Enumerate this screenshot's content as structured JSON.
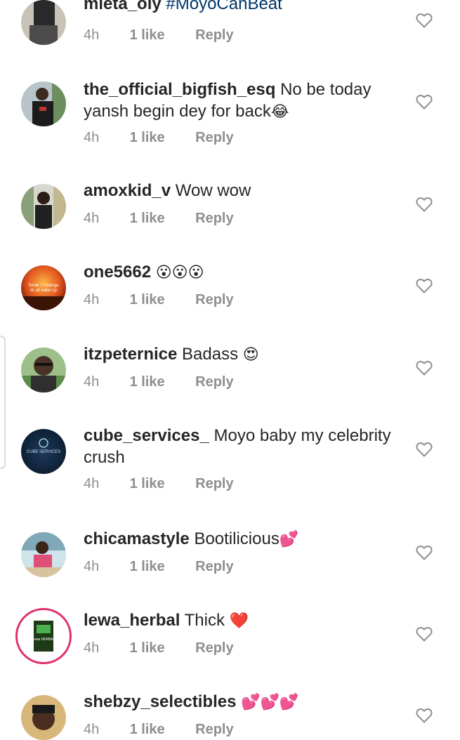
{
  "comments": [
    {
      "username": "mieta_oly",
      "text": "#MoyoCanBeat",
      "time": "4h",
      "likes": "1 like",
      "reply": "Reply"
    },
    {
      "username": "the_official_bigfish_esq",
      "text": "No be today yansh begin dey for back",
      "emoji": "😂",
      "time": "4h",
      "likes": "1 like",
      "reply": "Reply"
    },
    {
      "username": "amoxkid_v",
      "text": "Wow wow",
      "time": "4h",
      "likes": "1 like",
      "reply": "Reply"
    },
    {
      "username": "one5662",
      "text": "",
      "emoji": "😮😮😮",
      "time": "4h",
      "likes": "1 like",
      "reply": "Reply",
      "avatar_text": "Smile ! I change its all wake up"
    },
    {
      "username": "itzpeternice",
      "text": "Badass",
      "emoji": "😍",
      "time": "4h",
      "likes": "1 like",
      "reply": "Reply"
    },
    {
      "username": "cube_services_",
      "text": "Moyo baby my celebrity crush",
      "time": "4h",
      "likes": "1 like",
      "reply": "Reply",
      "avatar_text": "CUBE SERVICES"
    },
    {
      "username": "chicamastyle",
      "text": "Bootilicious",
      "emoji": "💕",
      "time": "4h",
      "likes": "1 like",
      "reply": "Reply"
    },
    {
      "username": "lewa_herbal",
      "text": "Thick",
      "emoji": "❤️",
      "time": "4h",
      "likes": "1 like",
      "reply": "Reply",
      "avatar_text": "Lewa HERBAL"
    },
    {
      "username": "shebzy_selectibles",
      "text": "",
      "emoji": "💕💕💕",
      "time": "4h",
      "likes": "1 like",
      "reply": "Reply"
    }
  ],
  "icons": {
    "like": "heart-outline-icon"
  },
  "colors": {
    "meta": "#8e8e8e",
    "story_ring": "#e1306c",
    "hashtag": "#003569"
  }
}
